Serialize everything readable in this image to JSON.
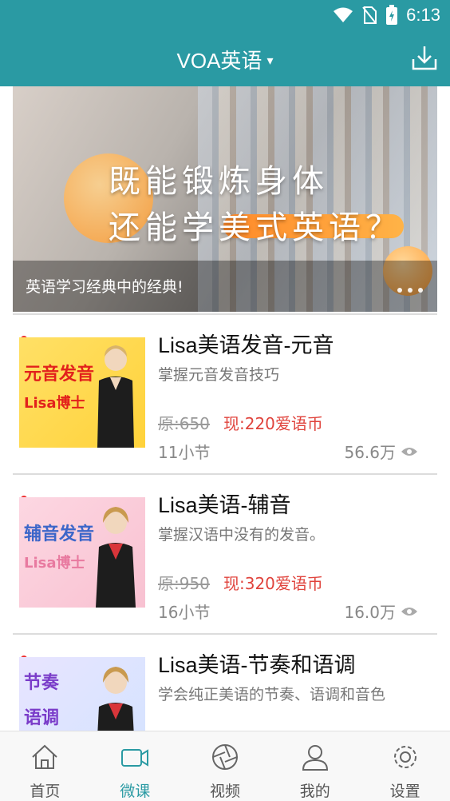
{
  "status_bar": {
    "time": "6:13"
  },
  "app_bar": {
    "title": "VOA英语",
    "caret": "▾"
  },
  "banner": {
    "headline_line1": "既能锻炼身体",
    "headline_line2": "还能学美式英语？",
    "caption": "英语学习经典中的经典!"
  },
  "courses": [
    {
      "name": "Lisa美语发音-元音",
      "description": "掌握元音发音技巧",
      "original_price": "原:650",
      "price": "现:220爱语币",
      "sections": "11小节",
      "views": "56.6万",
      "thumb_title": "元音发音",
      "thumb_sub": "Lisa博士"
    },
    {
      "name": "Lisa美语-辅音",
      "description": "掌握汉语中没有的发音。",
      "original_price": "原:950",
      "price": "现:320爱语币",
      "sections": "16小节",
      "views": "16.0万",
      "thumb_title": "辅音发音",
      "thumb_sub": "Lisa博士"
    },
    {
      "name": "Lisa美语-节奏和语调",
      "description": "学会纯正美语的节奏、语调和音色",
      "thumb_title": "节奏",
      "thumb_sub": "语调"
    }
  ],
  "tabs": [
    {
      "label": "首页",
      "icon": "home-icon"
    },
    {
      "label": "微课",
      "icon": "video-camera-icon"
    },
    {
      "label": "视频",
      "icon": "aperture-icon"
    },
    {
      "label": "我的",
      "icon": "user-icon"
    },
    {
      "label": "设置",
      "icon": "gear-icon"
    }
  ],
  "colors": {
    "primary": "#2a9aa3",
    "price_red": "#e0433c"
  }
}
